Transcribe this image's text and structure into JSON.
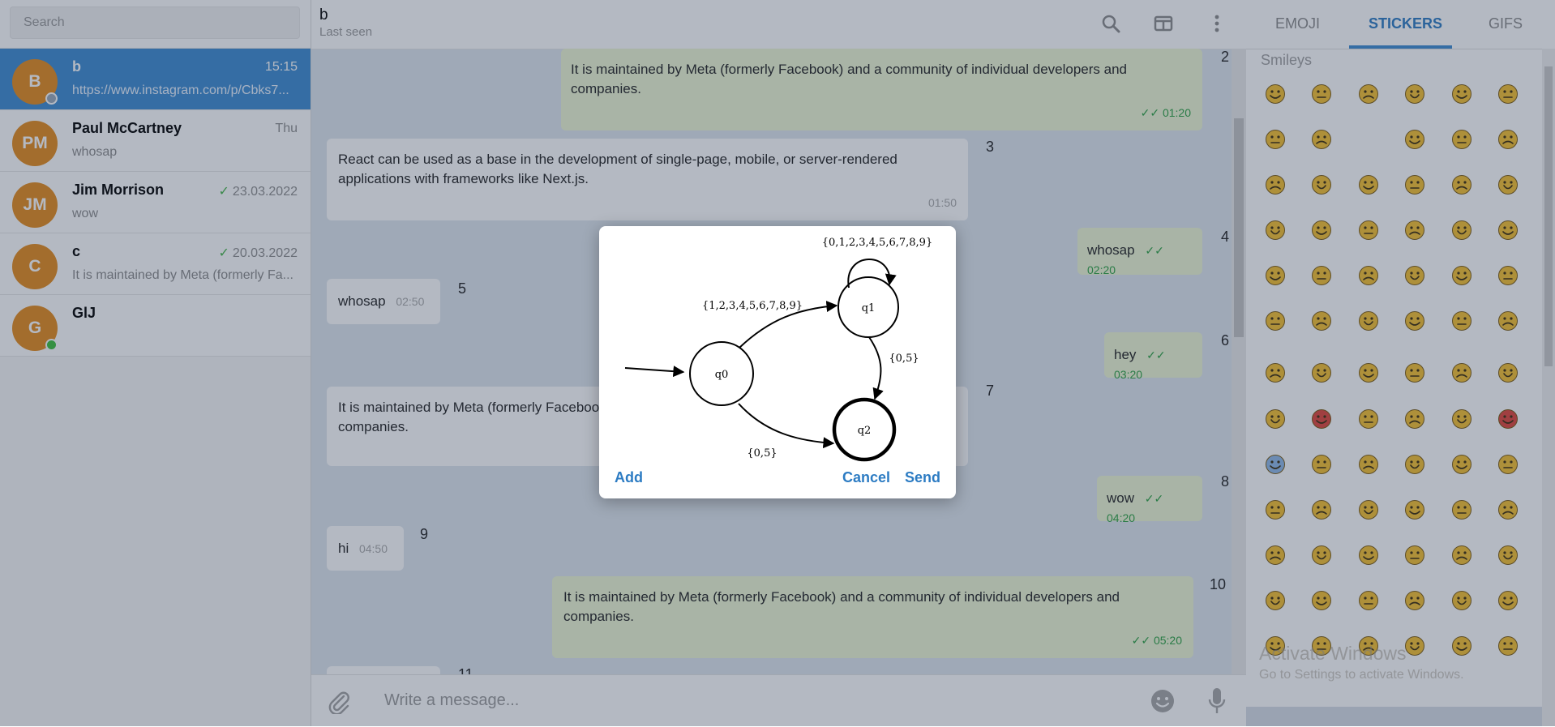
{
  "sidebar": {
    "search_placeholder": "Search",
    "chats": [
      {
        "initials": "B",
        "name": "b",
        "time": "15:15",
        "preview": "https://www.instagram.com/p/Cbks7...",
        "checked": false
      },
      {
        "initials": "PM",
        "name": "Paul McCartney",
        "time": "Thu",
        "preview": "whosap",
        "checked": false
      },
      {
        "initials": "JM",
        "name": "Jim Morrison",
        "time": "23.03.2022",
        "preview": "wow",
        "checked": true
      },
      {
        "initials": "C",
        "name": "c",
        "time": "20.03.2022",
        "preview": "It is maintained by Meta (formerly Fa...",
        "checked": true
      },
      {
        "initials": "G",
        "name": "GlJ",
        "time": "",
        "preview": "",
        "checked": false
      }
    ]
  },
  "header": {
    "title": "b",
    "subtitle": "Last seen"
  },
  "messages": [
    {
      "num": "2",
      "text": "It is maintained by Meta (formerly Facebook) and a community of individual developers and companies.",
      "time": "01:20"
    },
    {
      "num": "3",
      "text": "React can be used as a base in the development of single-page, mobile, or server-rendered applications with frameworks like Next.js.",
      "time": "01:50"
    },
    {
      "num": "4",
      "text": "whosap",
      "time": "02:20"
    },
    {
      "num": "5",
      "text": "whosap",
      "time": "02:50"
    },
    {
      "num": "6",
      "text": "hey",
      "time": "03:20"
    },
    {
      "num": "7",
      "text": "It is maintained by Meta (formerly Facebook) and a community of individual developers and companies.",
      "time": ""
    },
    {
      "num": "8",
      "text": "wow",
      "time": "04:20"
    },
    {
      "num": "9",
      "text": "hi",
      "time": "04:50"
    },
    {
      "num": "10",
      "text": "It is maintained by Meta (formerly Facebook) and a community of individual developers and companies.",
      "time": "05:20"
    },
    {
      "num": "11",
      "text": "",
      "time": ""
    }
  ],
  "composer": {
    "placeholder": "Write a message..."
  },
  "modal": {
    "diagram": {
      "states": [
        "q0",
        "q1",
        "q2"
      ],
      "labels": {
        "loop": "{0,1,2,3,4,5,6,7,8,9}",
        "q0_q1": "{1,2,3,4,5,6,7,8,9}",
        "q1_q2": "{0,5}",
        "q0_q2": "{0,5}"
      }
    },
    "add_label": "Add",
    "cancel_label": "Cancel",
    "send_label": "Send"
  },
  "right_panel": {
    "tabs": [
      "EMOJI",
      "STICKERS",
      "GIFS"
    ],
    "active_tab": "STICKERS",
    "section_label": "Smileys",
    "emoji_rows": 10
  },
  "watermark": {
    "line1": "Activate Windows",
    "line2": "Go to Settings to activate Windows."
  },
  "colors": {
    "accent": "#3d8bd1",
    "avatar": "#e58a1b",
    "outgoing": "#eef8d5",
    "read_check": "#2da143",
    "emoji_yellow": "#f6c12f"
  }
}
